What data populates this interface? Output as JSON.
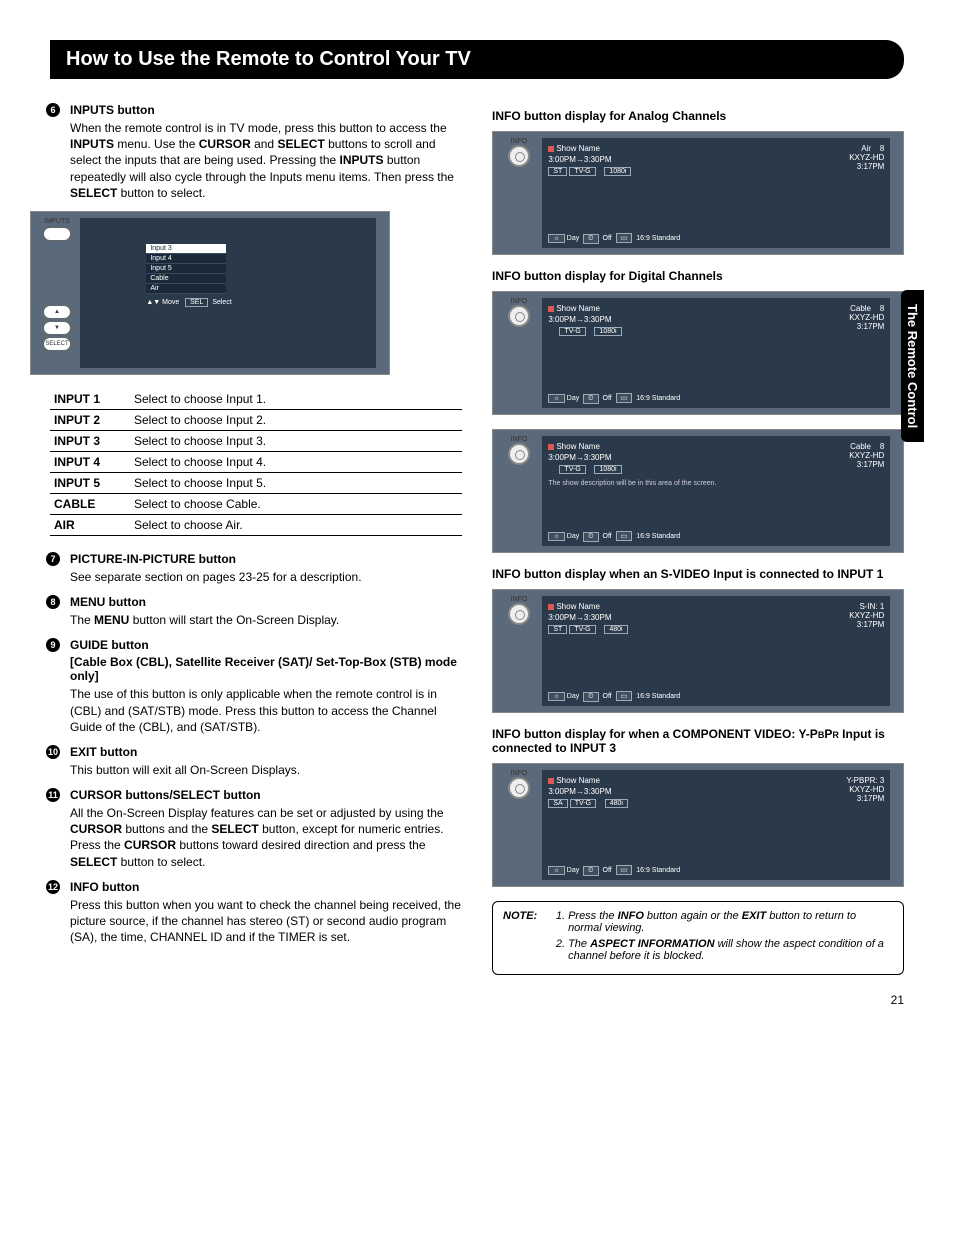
{
  "page_title": "How to Use the Remote to Control Your TV",
  "side_tab": "The Remote Control",
  "page_number": "21",
  "left": {
    "items6": {
      "num": "6",
      "title": "INPUTS button",
      "body_1": "When the remote control is in TV mode, press this button to access the ",
      "body_inputs": "INPUTS",
      "body_2": " menu. Use the ",
      "body_cursor": "CURSOR",
      "body_3": " and ",
      "body_select": "SELECT",
      "body_4": " buttons to scroll and select the inputs that are being used. Pressing the ",
      "body_inputs2": "INPUTS",
      "body_5": " button repeatedly will also cycle through the Inputs menu items. Then press the ",
      "body_select2": "SELECT",
      "body_6": " button to select."
    },
    "inputs_screen": {
      "label_inputs": "INPUTS",
      "label_select": "SELECT",
      "list": [
        "Input 3",
        "Input 4",
        "Input 5",
        "Cable",
        "Air"
      ],
      "footer_move": "Move",
      "footer_sel": "Select",
      "footer_sel_key": "SEL"
    },
    "inputs_table": [
      {
        "k": "INPUT 1",
        "v": "Select to choose Input 1."
      },
      {
        "k": "INPUT 2",
        "v": "Select to choose Input 2."
      },
      {
        "k": "INPUT 3",
        "v": "Select to choose Input 3."
      },
      {
        "k": "INPUT 4",
        "v": "Select to choose Input 4."
      },
      {
        "k": "INPUT 5",
        "v": "Select to choose Input 5."
      },
      {
        "k": "CABLE",
        "v": "Select to choose Cable."
      },
      {
        "k": "AIR",
        "v": "Select to choose Air."
      }
    ],
    "item7": {
      "num": "7",
      "title": "PICTURE-IN-PICTURE button",
      "body": "See separate section on pages 23-25 for a description."
    },
    "item8": {
      "num": "8",
      "title": "MENU button",
      "body_1": "The ",
      "b1": "MENU",
      "body_2": " button will start the On-Screen Display."
    },
    "item9": {
      "num": "9",
      "title": "GUIDE button",
      "sub": "[Cable Box (CBL), Satellite Receiver (SAT)/ Set-Top-Box (STB) mode only]",
      "body": "The use of this button is only applicable when the remote control is in (CBL) and (SAT/STB) mode. Press this button to access the Channel Guide of the (CBL), and (SAT/STB)."
    },
    "item10": {
      "num": "10",
      "title": "EXIT button",
      "body": "This button will exit all On-Screen Displays."
    },
    "item11": {
      "num": "11",
      "title": "CURSOR buttons/SELECT button",
      "body_1": "All the On-Screen Display features can be set or adjusted by using the ",
      "b1": "CURSOR",
      "body_2": " buttons and the ",
      "b2": "SELECT",
      "body_3": " button, except for numeric entries. Press the ",
      "b3": "CURSOR",
      "body_4": " buttons toward desired direction and press the ",
      "b4": "SELECT",
      "body_5": " button to select."
    },
    "item12": {
      "num": "12",
      "title": "INFO button",
      "body": "Press this button when you want to check the channel being received, the picture source, if the channel has stereo (ST) or second audio program (SA), the time, CHANNEL ID and if the TIMER is set."
    }
  },
  "right": {
    "h_analog": "INFO button display for Analog Channels",
    "h_digital": "INFO button display for Digital Channels",
    "h_svideo": "INFO button display when an S-VIDEO Input is connected to INPUT 1",
    "h_component_1": "INFO button display for when a COMPONENT VIDEO: Y-P",
    "h_component_sub1": "B",
    "h_component_2": "P",
    "h_component_sub2": "R",
    "h_component_3": " Input is connected to INPUT 3",
    "info_label": "INFO",
    "banner_common": {
      "show": "Show Name",
      "time": "3:00PM→3:30PM",
      "st": "ST",
      "sa": "SA",
      "tvg": "TV-G",
      "r1080i": "1080i",
      "r480i": "480i",
      "call": "KXYZ-HD",
      "now": "3:17PM",
      "air": "Air",
      "cable": "Cable",
      "ch8": "8",
      "sin1": "S-IN: 1",
      "ypbpr3": "Y-PBPR: 3",
      "desc": "The show description will be in this area of the screen.",
      "day": "Day",
      "off": "Off",
      "aspect": "16:9 Standard"
    }
  },
  "note": {
    "label": "NOTE:",
    "n1_a": "Press the ",
    "n1_b1": "INFO",
    "n1_b": " button again or the ",
    "n1_b2": "EXIT",
    "n1_c": " button to return to normal viewing.",
    "n2_a": "The ",
    "n2_b1": "ASPECT INFORMATION",
    "n2_b": " will show the aspect condition of a channel before it is blocked."
  }
}
